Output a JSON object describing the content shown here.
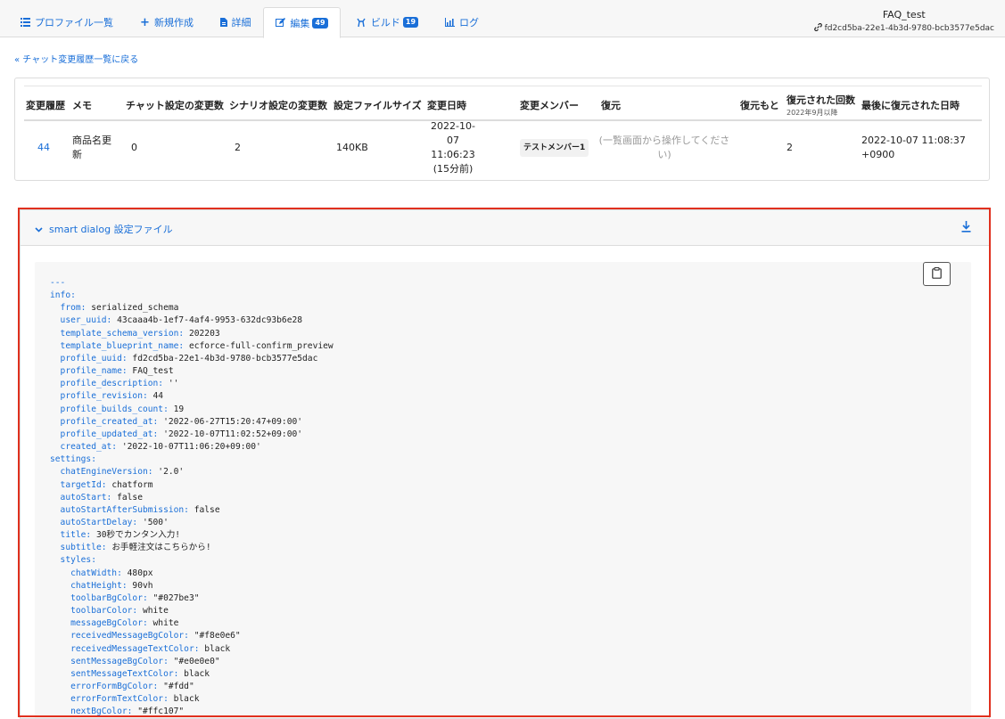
{
  "tabs": [
    {
      "label": "プロファイル一覧",
      "icon": "list-icon"
    },
    {
      "label": "新規作成",
      "icon": "plus-icon"
    },
    {
      "label": "詳細",
      "icon": "document-icon"
    },
    {
      "label": "編集",
      "icon": "edit-icon",
      "badge": "49",
      "active": true
    },
    {
      "label": "ビルド",
      "icon": "build-icon",
      "badge": "19"
    },
    {
      "label": "ログ",
      "icon": "chart-icon"
    }
  ],
  "profile": {
    "name": "FAQ_test",
    "uuid": "fd2cd5ba-22e1-4b3d-9780-bcb3577e5dac"
  },
  "back_link": "« チャット変更履歴一覧に戻る",
  "history_table": {
    "headers": [
      "変更履歴",
      "メモ",
      "チャット設定の変更数",
      "シナリオ設定の変更数",
      "設定ファイルサイズ",
      "変更日時",
      "変更メンバー",
      "復元",
      "復元もと",
      "復元された回数",
      "最後に復元された日時"
    ],
    "restore_count_sub": "2022年9月以降",
    "row": {
      "revision": "44",
      "memo_line1": "商品名更",
      "memo_line2": "新",
      "chat_changes": "0",
      "scenario_changes": "2",
      "file_size": "140KB",
      "date_line1": "2022-10-07",
      "date_line2": "11:06:23",
      "date_line3": "(15分前)",
      "member": "テストメンバー1",
      "restore_line1": "(一覧画面から操作してくださ",
      "restore_line2": "い)",
      "restore_source": "",
      "restore_count": "2",
      "last_restored_line1": "2022-10-07 11:08:37",
      "last_restored_line2": "+0900"
    }
  },
  "config_panel": {
    "title": "smart dialog 設定ファイル",
    "code_lines": [
      {
        "k": "---",
        "v": ""
      },
      {
        "k": "info:",
        "v": ""
      },
      {
        "k": "  from:",
        "v": " serialized_schema"
      },
      {
        "k": "  user_uuid:",
        "v": " 43caaa4b-1ef7-4af4-9953-632dc93b6e28"
      },
      {
        "k": "  template_schema_version:",
        "v": " 202203"
      },
      {
        "k": "  template_blueprint_name:",
        "v": " ecforce-full-confirm_preview"
      },
      {
        "k": "  profile_uuid:",
        "v": " fd2cd5ba-22e1-4b3d-9780-bcb3577e5dac"
      },
      {
        "k": "  profile_name:",
        "v": " FAQ_test"
      },
      {
        "k": "  profile_description:",
        "v": " ''"
      },
      {
        "k": "  profile_revision:",
        "v": " 44"
      },
      {
        "k": "  profile_builds_count:",
        "v": " 19"
      },
      {
        "k": "  profile_created_at:",
        "v": " '2022-06-27T15:20:47+09:00'"
      },
      {
        "k": "  profile_updated_at:",
        "v": " '2022-10-07T11:02:52+09:00'"
      },
      {
        "k": "  created_at:",
        "v": " '2022-10-07T11:06:20+09:00'"
      },
      {
        "k": "settings:",
        "v": ""
      },
      {
        "k": "  chatEngineVersion:",
        "v": " '2.0'"
      },
      {
        "k": "  targetId:",
        "v": " chatform"
      },
      {
        "k": "  autoStart:",
        "v": " false"
      },
      {
        "k": "  autoStartAfterSubmission:",
        "v": " false"
      },
      {
        "k": "  autoStartDelay:",
        "v": " '500'"
      },
      {
        "k": "  title:",
        "v": " 30秒でカンタン入力!"
      },
      {
        "k": "  subtitle:",
        "v": " お手軽注文はこちらから!"
      },
      {
        "k": "  styles:",
        "v": ""
      },
      {
        "k": "    chatWidth:",
        "v": " 480px"
      },
      {
        "k": "    chatHeight:",
        "v": " 90vh"
      },
      {
        "k": "    toolbarBgColor:",
        "v": " \"#027be3\""
      },
      {
        "k": "    toolbarColor:",
        "v": " white"
      },
      {
        "k": "    messageBgColor:",
        "v": " white"
      },
      {
        "k": "    receivedMessageBgColor:",
        "v": " \"#f8e0e6\""
      },
      {
        "k": "    receivedMessageTextColor:",
        "v": " black"
      },
      {
        "k": "    sentMessageBgColor:",
        "v": " \"#e0e0e0\""
      },
      {
        "k": "    sentMessageTextColor:",
        "v": " black"
      },
      {
        "k": "    errorFormBgColor:",
        "v": " \"#fdd\""
      },
      {
        "k": "    errorFormTextColor:",
        "v": " black"
      },
      {
        "k": "    nextBgColor:",
        "v": " \"#ffc107\""
      }
    ]
  },
  "colors": {
    "accent": "#1a6fd8",
    "highlight_border": "#e0301e"
  }
}
